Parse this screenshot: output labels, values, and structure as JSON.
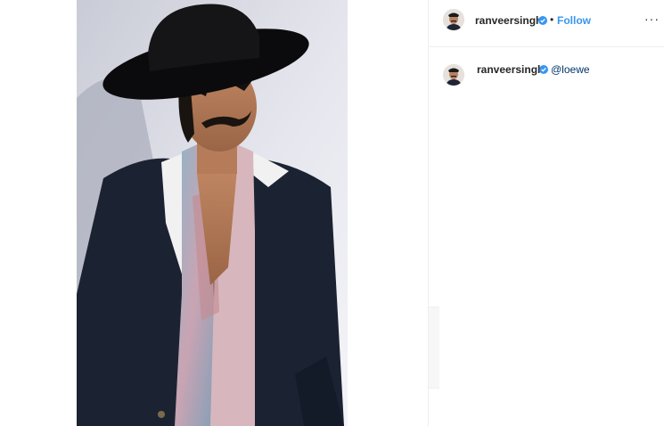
{
  "post": {
    "image_alt": "Man in black hat, cat-eye sunglasses, dark blazer with white lapels and floral paisley shirt",
    "author": {
      "username": "ranveersingh",
      "verified": true
    },
    "header": {
      "separator": "•",
      "follow_label": "Follow",
      "more_label": "···"
    },
    "caption": {
      "username": "ranveersingh",
      "text": "@loewe"
    }
  },
  "colors": {
    "accent": "#3897f0",
    "verified": "#3897f0",
    "text": "#262626"
  }
}
